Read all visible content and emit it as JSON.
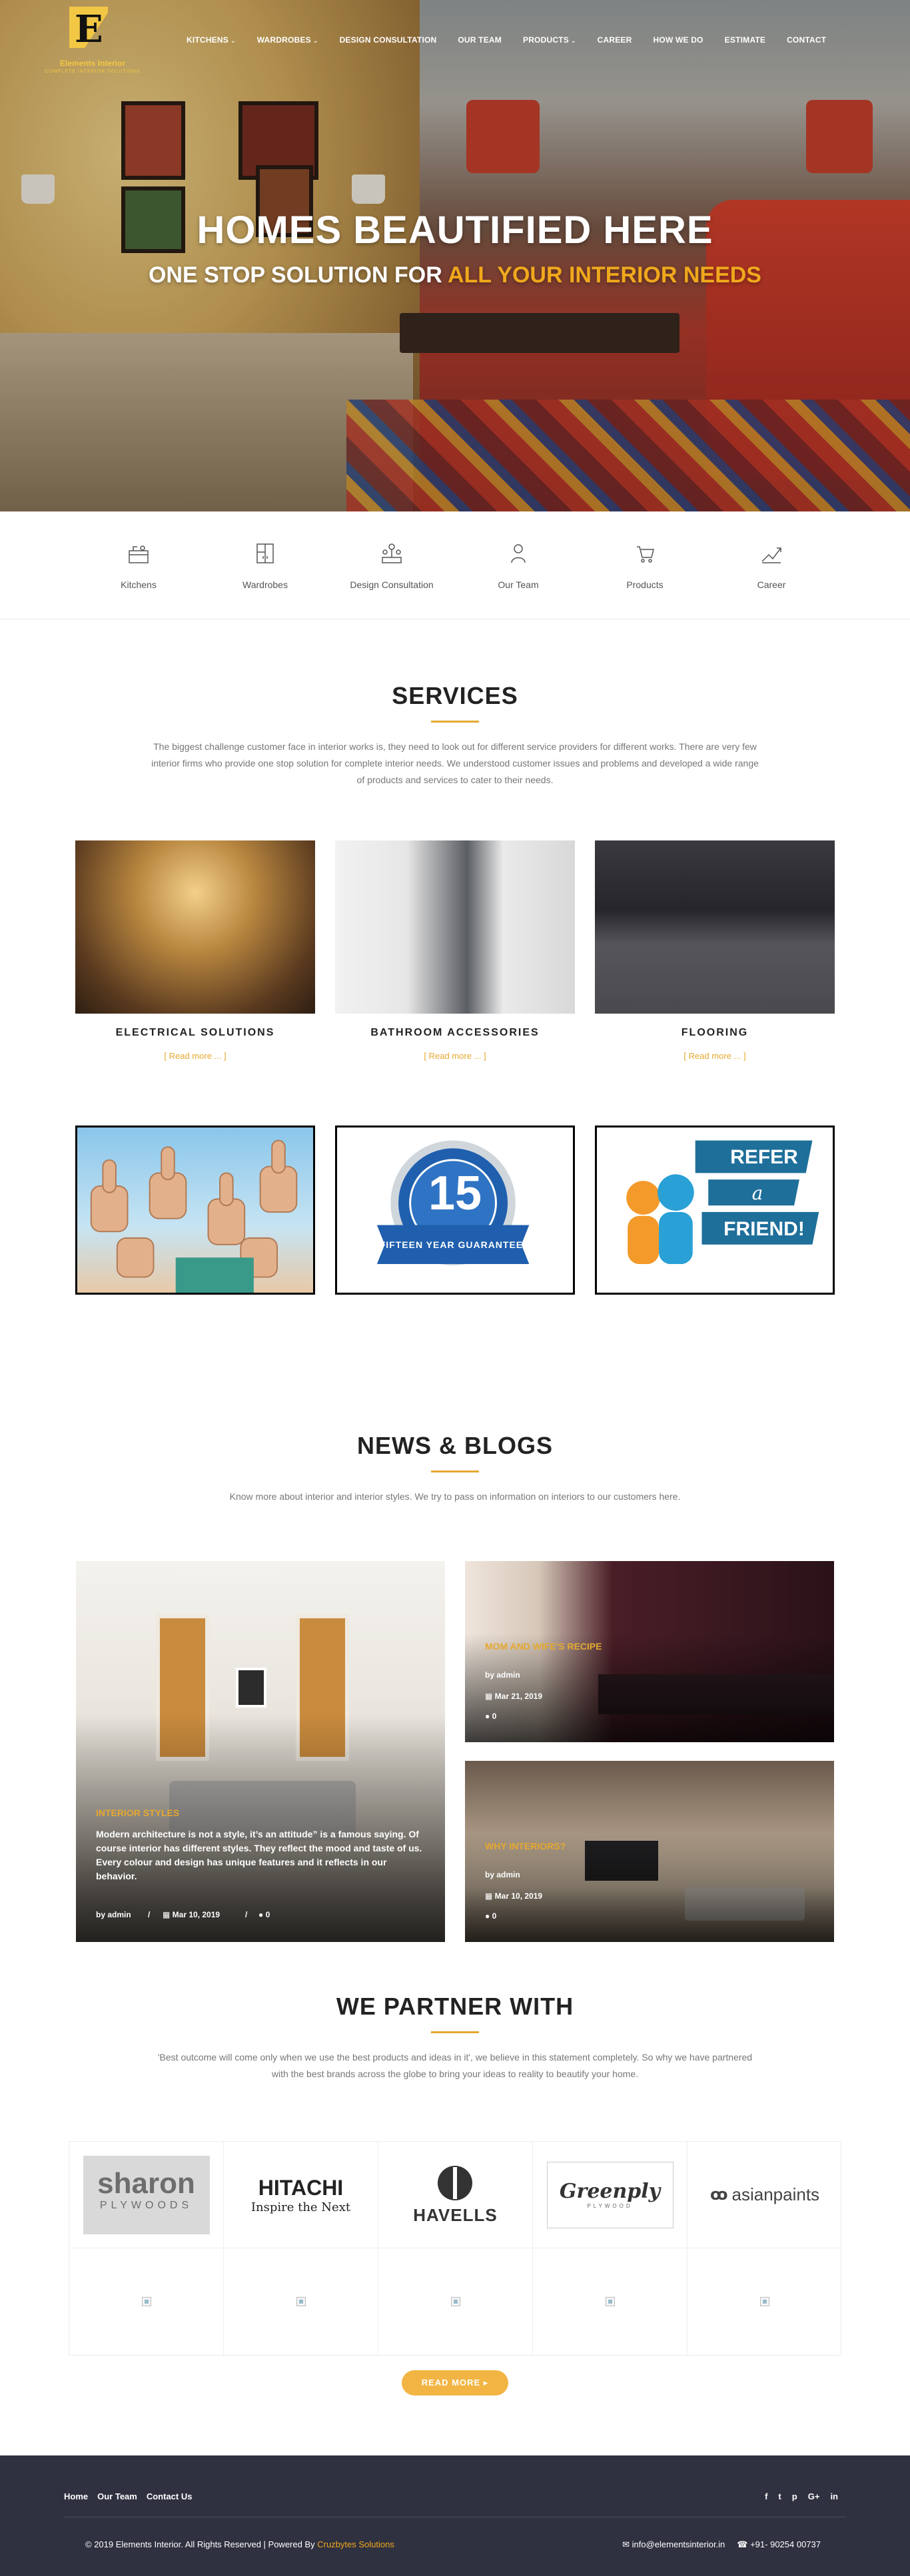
{
  "brand": {
    "letter": "E",
    "name": "Elements Interior",
    "tagline": "COMPLETE INTERIOR SOLUTIONS",
    "accent": "#f0a81c",
    "dark": "#2f3140"
  },
  "nav": {
    "items": [
      {
        "label": "KITCHENS",
        "dropdown": true
      },
      {
        "label": "WARDROBES",
        "dropdown": true
      },
      {
        "label": "DESIGN CONSULTATION",
        "dropdown": false
      },
      {
        "label": "OUR TEAM",
        "dropdown": false
      },
      {
        "label": "PRODUCTS",
        "dropdown": true
      },
      {
        "label": "CAREER",
        "dropdown": false
      },
      {
        "label": "HOW WE DO",
        "dropdown": false
      },
      {
        "label": "ESTIMATE",
        "dropdown": false
      },
      {
        "label": "CONTACT",
        "dropdown": false
      }
    ]
  },
  "hero": {
    "title": "HOMES BEAUTIFIED HERE",
    "sub_white": "ONE STOP SOLUTION FOR",
    "sub_accent": "ALL YOUR INTERIOR NEEDS"
  },
  "iconstrip": {
    "items": [
      {
        "label": "Kitchens",
        "icon": "kitchen-icon"
      },
      {
        "label": "Wardrobes",
        "icon": "wardrobe-icon"
      },
      {
        "label": "Design Consultation",
        "icon": "consultation-icon"
      },
      {
        "label": "Our Team",
        "icon": "team-icon"
      },
      {
        "label": "Products",
        "icon": "products-icon"
      },
      {
        "label": "Career",
        "icon": "career-icon"
      }
    ]
  },
  "services": {
    "title": "SERVICES",
    "text": "The biggest challenge customer face in interior works is, they need to look out for different service providers for different works. There are very few interior firms who provide one stop solution for complete interior needs. We understood customer issues and problems and developed a wide range of products and services to cater to their needs.",
    "items": [
      {
        "title": "ELECTRICAL SOLUTIONS",
        "read_more": "[ Read more ... ]"
      },
      {
        "title": "BATHROOM ACCESSORIES",
        "read_more": "[ Read more ... ]"
      },
      {
        "title": "FLOORING",
        "read_more": "[ Read more ... ]"
      }
    ]
  },
  "promo": {
    "badge_number": "15",
    "badge_ribbon": "FIFTEEN YEAR GUARANTEED",
    "refer": [
      "REFER",
      "a",
      "FRIEND!"
    ]
  },
  "news": {
    "title": "NEWS & BLOGS",
    "text": "Know more about interior and interior styles. We try to pass on information on interiors to our customers here.",
    "posts": [
      {
        "category": "INTERIOR STYLES",
        "excerpt": "Modern architecture is not a style, it’s an attitude” is a famous saying. Of course interior has different styles. They reflect the mood and taste of us. Every colour and design has unique features and it reflects in our behavior.",
        "by": "by admin",
        "date": "Mar 10, 2019",
        "comments": "0",
        "sep": "/"
      },
      {
        "category": "MOM AND WIFE'S RECIPE",
        "by": "by admin",
        "date": "Mar 21, 2019",
        "comments": "0"
      },
      {
        "category": "WHY INTERIORS?",
        "by": "by admin",
        "date": "Mar 10, 2019",
        "comments": "0"
      }
    ]
  },
  "partners": {
    "title": "WE PARTNER WITH",
    "text": "'Best outcome will come only when we use the best products and ideas in it', we believe in this statement completely. So why we have partnered with the best brands across the globe to bring your ideas to reality to beautify your home.",
    "logos": [
      {
        "line1": "sharon",
        "line2": "PLYWOODS"
      },
      {
        "line1": "HITACHI",
        "line2": "Inspire the Next"
      },
      {
        "line1": "HAVELLS"
      },
      {
        "line1": "Greenply",
        "line2": "PLYWOOD"
      },
      {
        "line1": "asianpaints"
      }
    ],
    "button": "READ MORE ▸"
  },
  "footer": {
    "links": [
      "Home",
      "Our Team",
      "Contact Us"
    ],
    "social": [
      "f",
      "t",
      "p",
      "G+",
      "in"
    ],
    "copy": "© 2019 Elements Interior. All Rights Reserved | Powered By",
    "powered": "Cruzbytes Solutions",
    "email": "info@elementsinterior.in",
    "phone": "+91- 90254 00737"
  }
}
